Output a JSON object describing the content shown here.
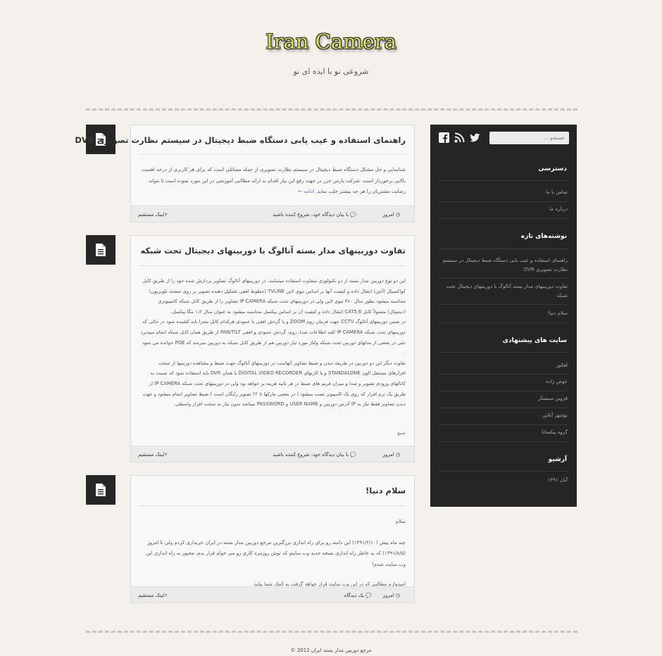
{
  "site": {
    "title": "Iran Camera",
    "description": "شروعی نو با ایده ای نو"
  },
  "posts": [
    {
      "title": "راهنمای استفاده و عیب یابی دستگاه ضبط دیجیتال در سیستم نظارت تصویری DVR",
      "body": "شناسایی و حل مشکل دستگاه ضبط دیجیتال در سیستم نظارت تصویری از جمله مسائلی است که برای هر کاربری از درجه اهمیت بالایی برخوردار است. شرکت پارس خزر در جهت رفع این نیاز اقدام به ارائه مطالبی آموزشی در این مورد نموده است تا بتواند رضایت مشتریان را هر چه بیشتر جلب نماید.",
      "more": "ادامه ←",
      "date": "امروز",
      "comments": "با بیان دیدگاه خود، شروع کننده باشید",
      "permalink": "لینک مستقیم"
    },
    {
      "title": "تفاوت دوربینهای مدار بسته آنالوگ با دوربینهای دیجیتال تحت شبکه",
      "paragraphs": [
        "این دو نوع دوربین مدار بسته از دو تکنولوژی متفاوت استفاده مینمایند. در دوربینهای آنالوگ تصاویر پردازش شده خود را از طریق کابل کواکسیال (آنتن) انتقال داده و کیفیت آنها بر اساس تیوی لاین TVLINE (خطوط افقی تشکیل دهنده تصویر بر روی صفحه تلویزیون) محاسبه میشود بطور مثال ۴۸۰ تیوی لاین ولی در دوربینهای تحت شبکه IP CAMERA تصاویر را از طریق کابل شبکه کامپیوتری (دیجیتال) معمولاً کابل CAT5,6 انتقال داده و کیفیت آن بر اساس پیکسل محاسبه میشود به عنوان مثال ۱٫۳ مگا پیکسل.",
        "در ضمن دوربینهای آنالوگ CCTV جهت فرمان زوم ZOOM و یا گردش افقی یا عمودی هرکدام کابل مجزا باید کشیده شود در حالی که دوربینهای تحت شبکه IP CAMERA کلیه اطلاعات صدا، زوم، گردش عمودی و افقی PAN/TILT از طریق همان کابل شبکه انجام میپذیرد حتی در بعضی از مدلهای دوربین تحت شبکه ولتاژ مورد نیاز دوربین هم از طریق کابل شبکه به دوربین میرسد که POE خوانده می شود .",
        "تفاوت دیگر این دو دوربین در طریقه دیدن و ضبط تصاویر آنهاست در دوربینهای آنالوگ جهت ضبط و مشاهده دوربینها از سخت افزارهای مستقل الون STANDALONE و یا کارتهای DIGITAL VIDEO RECORDER یا همان DVR باید استفاده نمود که نسبت به کانالهای ورودی تصویر و صدا و میزان فریم های ضبط در هر ثانیه هزینه بر خواهد بود ولی در دوربینهای تحت شبکه IP CAMERA از طریق یک نرم افزار که روی یک کامپیوتر نصب میشود ( در بعضی مارکها تا ۲۲ تصویر رایگان است ) ضبط تصاویر انجام میشود و جهت دیدن تصاویر فقط نیاز به IP آدرس دوربین و USER NAME و PASSWORD میباشد بدون نیاز به سخت افزار واسطی."
      ],
      "source": "منبع",
      "date": "امروز",
      "comments": "با بیان دیدگاه خود، شروع کننده باشید",
      "permalink": "لینک مستقیم"
    },
    {
      "title": "سلام دنیا!",
      "paragraphs": [
        "سلام",
        "چند ماه پیش (۱۳۹۱/۲/۱۰) این دامنه رو برای راه اندازی بزرگترین مرجع دوربین مدار بسته در ایران خریداری کردم ولی تا امروز (۱۳۹۱/۸/۵) که به خاطر راه اندازی نسخه جدید وب سایتم که توش روزمره کاری رو می خوام قرار بدم، مجبور به راه اندازی این وب سایت شدم!",
        "امیدوارم مطالبی که در این وب سایت قرار خواهد گرفت به کمک شما بیاید."
      ],
      "date": "امروز",
      "comments": "یک دیدگاه",
      "permalink": "لینک مستقیم"
    }
  ],
  "sidebar": {
    "search_placeholder": "جستجو ...",
    "social": [
      "facebook-icon",
      "rss-icon",
      "twitter-icon"
    ],
    "access": {
      "heading": "دسترسی",
      "items": [
        "تماس با ما",
        "درباره ما"
      ]
    },
    "recent": {
      "heading": "نوشته‌های تازه",
      "items": [
        "راهنمای استفاده و عیب یابی دستگاه ضبط دیجیتال در سیستم نظارت تصویری DVR",
        "تفاوت دوربینهای مدار بسته آنالوگ با دوربینهای دیجیتال تحت شبکه",
        "سلام دنیا!"
      ]
    },
    "suggested": {
      "heading": "سایت های پیشنهادی",
      "items": [
        "اهکور",
        "عوض زاده",
        "قزوین سیستار",
        "نوشهر آنلاین",
        "گروه پیکسانا"
      ]
    },
    "archive": {
      "heading": "آرشیو",
      "items": [
        "آبان ۱۳۹۱"
      ]
    }
  },
  "footer": {
    "text": "مرجع دوربین مدار بسته ایران 2012 ©"
  },
  "colors": {
    "background": "#f4f0eb",
    "title": "#d8e05a",
    "sidebar": "#252525",
    "link": "#5577aa"
  }
}
